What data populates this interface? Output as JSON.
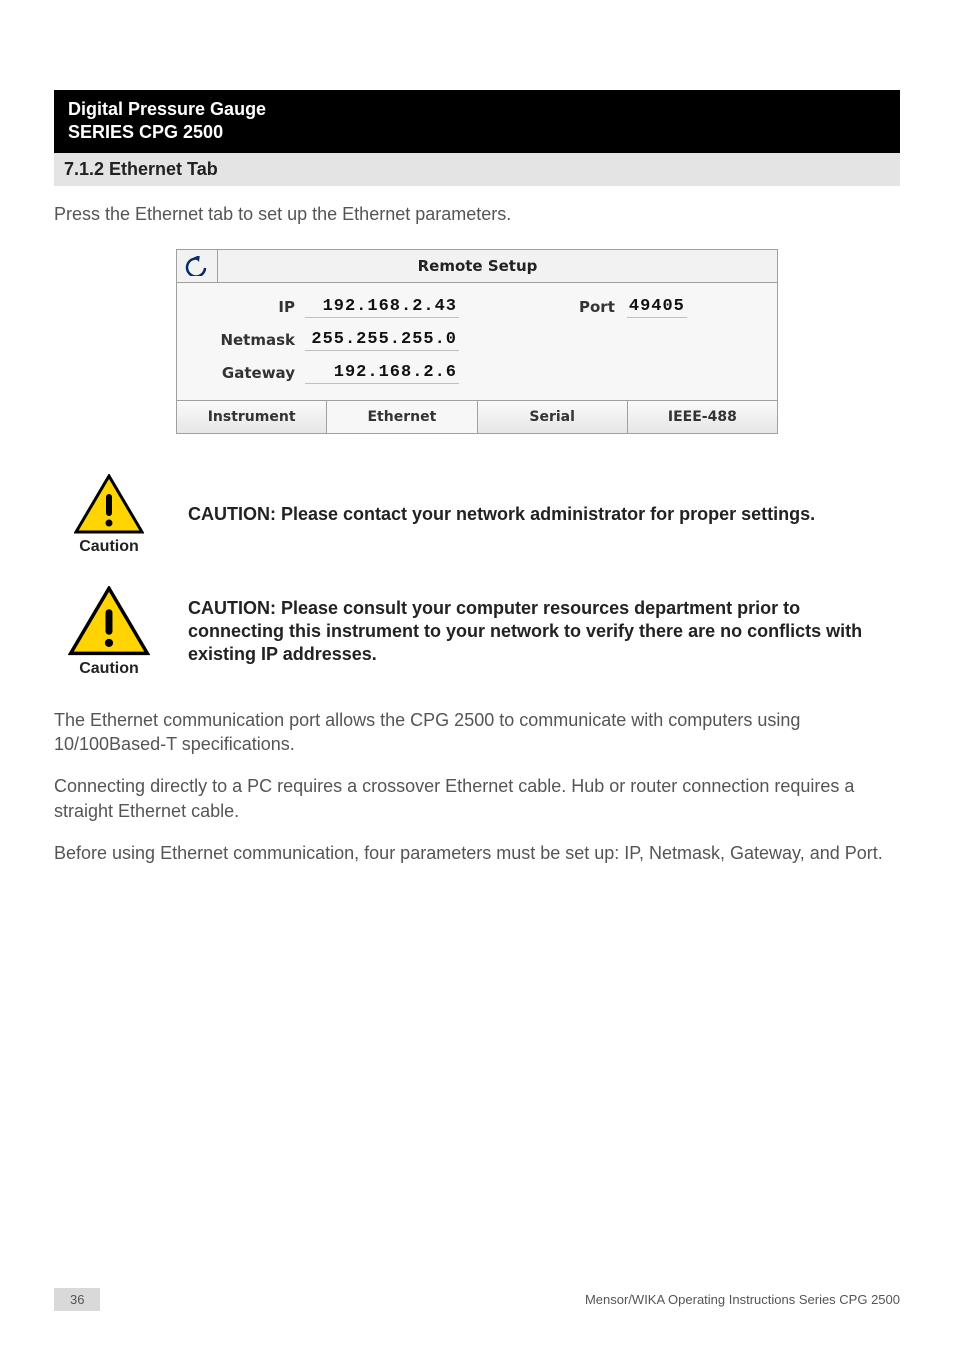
{
  "header": {
    "line1": "Digital Pressure Gauge",
    "line2": "SERIES CPG 2500"
  },
  "section_heading": "7.1.2 Ethernet Tab",
  "intro": "Press the Ethernet tab to set up the Ethernet parameters.",
  "panel": {
    "title": "Remote Setup",
    "back_icon_name": "back-arrow-icon",
    "fields": {
      "ip_label": "IP",
      "ip_value": "192.168.2.43",
      "netmask_label": "Netmask",
      "netmask_value": "255.255.255.0",
      "gateway_label": "Gateway",
      "gateway_value": "192.168.2.6",
      "port_label": "Port",
      "port_value": "49405"
    },
    "tabs": {
      "instrument": "Instrument",
      "ethernet": "Ethernet",
      "serial": "Serial",
      "ieee488": "IEEE-488"
    }
  },
  "caution1": {
    "label": "Caution",
    "text": "CAUTION: Please contact your network administrator for proper settings."
  },
  "caution2": {
    "label": "Caution",
    "text": "CAUTION: Please consult your computer resources department prior to connecting this instrument to your network to verify there are no conflicts with existing IP addresses."
  },
  "paragraphs": {
    "p1": "The Ethernet communication port allows the CPG 2500 to communicate with computers using 10/100Based-T specifications.",
    "p2": "Connecting directly to a PC requires a crossover Ethernet cable. Hub or router connection requires a straight Ethernet cable.",
    "p3": "Before using Ethernet communication, four parameters must be set up: IP, Netmask, Gateway, and Port."
  },
  "footer": {
    "page_number": "36",
    "text": "Mensor/WIKA Operating Instructions Series CPG 2500"
  }
}
